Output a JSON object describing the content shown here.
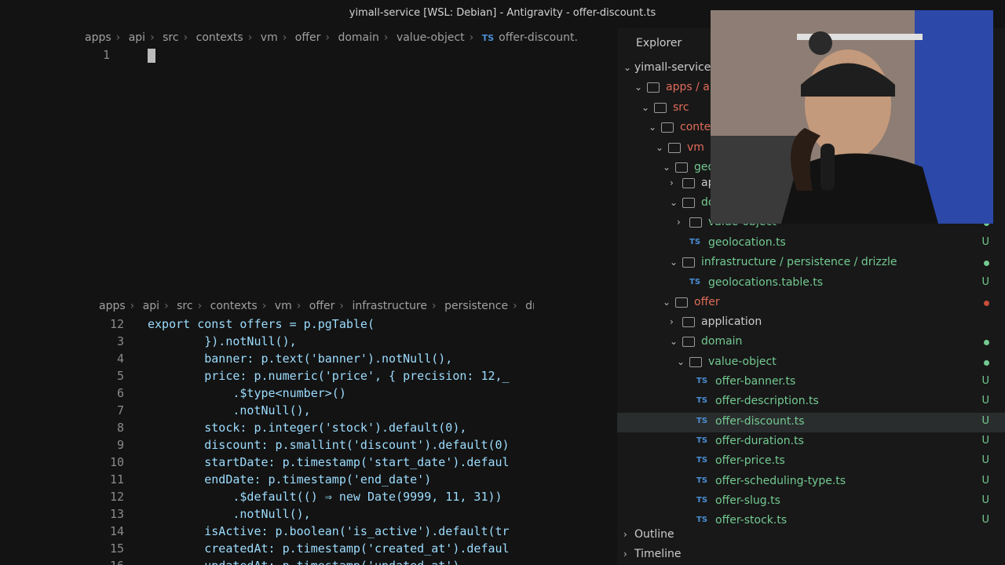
{
  "window": {
    "title": "yimall-service [WSL: Debian] - Antigravity - offer-discount.ts"
  },
  "top_editor": {
    "breadcrumb": [
      "apps",
      "api",
      "src",
      "contexts",
      "vm",
      "offer",
      "domain",
      "value-object"
    ],
    "file_icon": "TS",
    "file": "offer-discount.",
    "line_number": "1"
  },
  "bottom_editor": {
    "breadcrumb": [
      "apps",
      "api",
      "src",
      "contexts",
      "vm",
      "offer",
      "infrastructure",
      "persistence",
      "drizzle"
    ],
    "lines": [
      {
        "n": "12",
        "t": "export const offers = p.pgTable("
      },
      {
        "n": "3",
        "t": "        }).notNull(),"
      },
      {
        "n": "4",
        "t": "        banner: p.text('banner').notNull(),"
      },
      {
        "n": "5",
        "t": "        price: p.numeric('price', { precision: 12,_"
      },
      {
        "n": "6",
        "t": "            .$type<number>()"
      },
      {
        "n": "7",
        "t": "            .notNull(),"
      },
      {
        "n": "8",
        "t": "        stock: p.integer('stock').default(0),"
      },
      {
        "n": "9",
        "t": "        discount: p.smallint('discount').default(0)"
      },
      {
        "n": "10",
        "t": "        startDate: p.timestamp('start_date').defaul"
      },
      {
        "n": "11",
        "t": "        endDate: p.timestamp('end_date')"
      },
      {
        "n": "12",
        "t": "            .$default(() ⇒ new Date(9999, 11, 31))"
      },
      {
        "n": "13",
        "t": "            .notNull(),"
      },
      {
        "n": "14",
        "t": "        isActive: p.boolean('is_active').default(tr"
      },
      {
        "n": "15",
        "t": "        createdAt: p.timestamp('created_at').defaul"
      },
      {
        "n": "16",
        "t": "        updatedAt: p.timestamp('updated_at')"
      }
    ]
  },
  "explorer": {
    "header": "Explorer",
    "root": "yimall-service [",
    "rows": [
      {
        "label": "apps / ap",
        "kind": "folder",
        "color": "red"
      },
      {
        "label": "src",
        "kind": "folder",
        "color": "red"
      },
      {
        "label": "contex",
        "kind": "folder",
        "color": "red"
      },
      {
        "label": "vm",
        "kind": "folder",
        "color": "red"
      },
      {
        "label": "geo",
        "kind": "folder",
        "color": "green"
      },
      {
        "label": "ap",
        "kind": "folder",
        "color": "white"
      },
      {
        "label": "do",
        "kind": "folder",
        "color": "green"
      },
      {
        "label": "value-object",
        "kind": "folder",
        "color": "green"
      },
      {
        "label": "geolocation.ts",
        "kind": "file",
        "color": "green",
        "badge": "U"
      },
      {
        "label": "infrastructure / persistence / drizzle",
        "kind": "folder",
        "color": "green"
      },
      {
        "label": "geolocations.table.ts",
        "kind": "file",
        "color": "green",
        "badge": "U"
      },
      {
        "label": "offer",
        "kind": "folder",
        "color": "red"
      },
      {
        "label": "application",
        "kind": "folder",
        "color": "white"
      },
      {
        "label": "domain",
        "kind": "folder",
        "color": "green"
      },
      {
        "label": "value-object",
        "kind": "folder",
        "color": "green"
      },
      {
        "label": "offer-banner.ts",
        "kind": "file",
        "color": "green",
        "badge": "U"
      },
      {
        "label": "offer-description.ts",
        "kind": "file",
        "color": "green",
        "badge": "U"
      },
      {
        "label": "offer-discount.ts",
        "kind": "file",
        "color": "green",
        "badge": "U"
      },
      {
        "label": "offer-duration.ts",
        "kind": "file",
        "color": "green",
        "badge": "U"
      },
      {
        "label": "offer-price.ts",
        "kind": "file",
        "color": "green",
        "badge": "U"
      },
      {
        "label": "offer-scheduling-type.ts",
        "kind": "file",
        "color": "green",
        "badge": "U"
      },
      {
        "label": "offer-slug.ts",
        "kind": "file",
        "color": "green",
        "badge": "U"
      },
      {
        "label": "offer-stock.ts",
        "kind": "file",
        "color": "green",
        "badge": "U"
      }
    ],
    "outline": "Outline",
    "timeline": "Timeline"
  }
}
